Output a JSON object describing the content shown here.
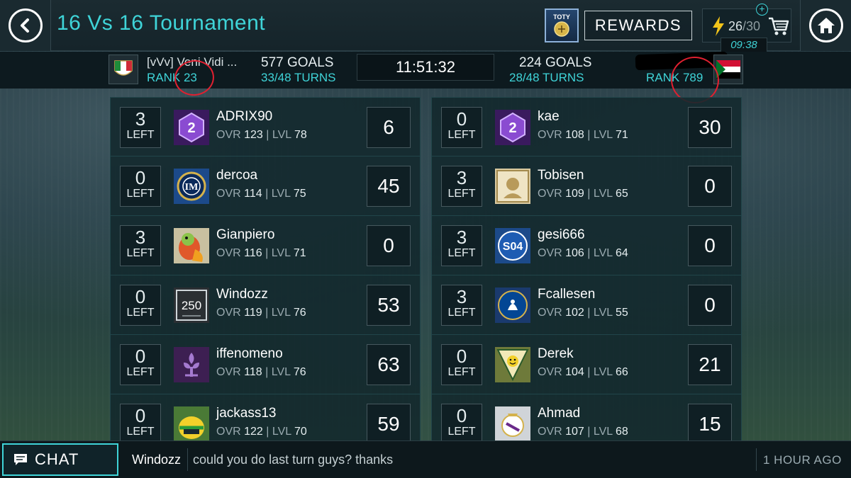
{
  "header": {
    "title": "16 Vs 16 Tournament",
    "back_icon": "chevron-left-icon",
    "home_icon": "home-icon",
    "rewards_label": "REWARDS",
    "energy_current": "26",
    "energy_max": "/30",
    "energy_timer": "09:38",
    "accent_color": "#3fd4d8"
  },
  "match": {
    "home": {
      "club": "[vVv] Veni Vidi ...",
      "rank": "RANK 23",
      "goals": "577 GOALS",
      "turns": "33/48 TURNS"
    },
    "clock": "11:51:32",
    "away": {
      "goals": "224 GOALS",
      "turns": "28/48 TURNS",
      "rank": "RANK 789"
    }
  },
  "left_team": [
    {
      "left": "3",
      "left_label": "LEFT",
      "name": "ADRIX90",
      "ovr": "123",
      "lvl": "78",
      "score": "6",
      "avatar": "division-2-badge"
    },
    {
      "left": "0",
      "left_label": "LEFT",
      "name": "dercoa",
      "ovr": "114",
      "lvl": "75",
      "score": "45",
      "avatar": "inter-crest"
    },
    {
      "left": "3",
      "left_label": "LEFT",
      "name": "Gianpiero",
      "ovr": "116",
      "lvl": "71",
      "score": "0",
      "avatar": "parrot-photo"
    },
    {
      "left": "0",
      "left_label": "LEFT",
      "name": "Windozz",
      "ovr": "119",
      "lvl": "76",
      "score": "53",
      "avatar": "250-badge"
    },
    {
      "left": "0",
      "left_label": "LEFT",
      "name": "iffenomeno",
      "ovr": "118",
      "lvl": "76",
      "score": "63",
      "avatar": "fiorentina-crest"
    },
    {
      "left": "0",
      "left_label": "LEFT",
      "name": "jackass13",
      "ovr": "122",
      "lvl": "70",
      "score": "59",
      "avatar": "helmet-photo"
    }
  ],
  "right_team": [
    {
      "left": "0",
      "left_label": "LEFT",
      "name": "kae",
      "ovr": "108",
      "lvl": "71",
      "score": "30",
      "avatar": "division-2-badge"
    },
    {
      "left": "3",
      "left_label": "LEFT",
      "name": "Tobisen",
      "ovr": "109",
      "lvl": "65",
      "score": "0",
      "avatar": "icon-badge"
    },
    {
      "left": "3",
      "left_label": "LEFT",
      "name": "gesi666",
      "ovr": "106",
      "lvl": "64",
      "score": "0",
      "avatar": "schalke-crest"
    },
    {
      "left": "3",
      "left_label": "LEFT",
      "name": "Fcallesen",
      "ovr": "102",
      "lvl": "55",
      "score": "0",
      "avatar": "chelsea-crest"
    },
    {
      "left": "0",
      "left_label": "LEFT",
      "name": "Derek",
      "ovr": "104",
      "lvl": "66",
      "score": "21",
      "avatar": "smiley-badge"
    },
    {
      "left": "0",
      "left_label": "LEFT",
      "name": "Ahmad",
      "ovr": "107",
      "lvl": "68",
      "score": "15",
      "avatar": "real-madrid-crest"
    }
  ],
  "labels": {
    "ovr": "OVR ",
    "lvl": " | LVL "
  },
  "chat": {
    "button_label": "CHAT",
    "user": "Windozz",
    "message": "could you do last turn guys? thanks",
    "time": "1 HOUR  AGO"
  }
}
